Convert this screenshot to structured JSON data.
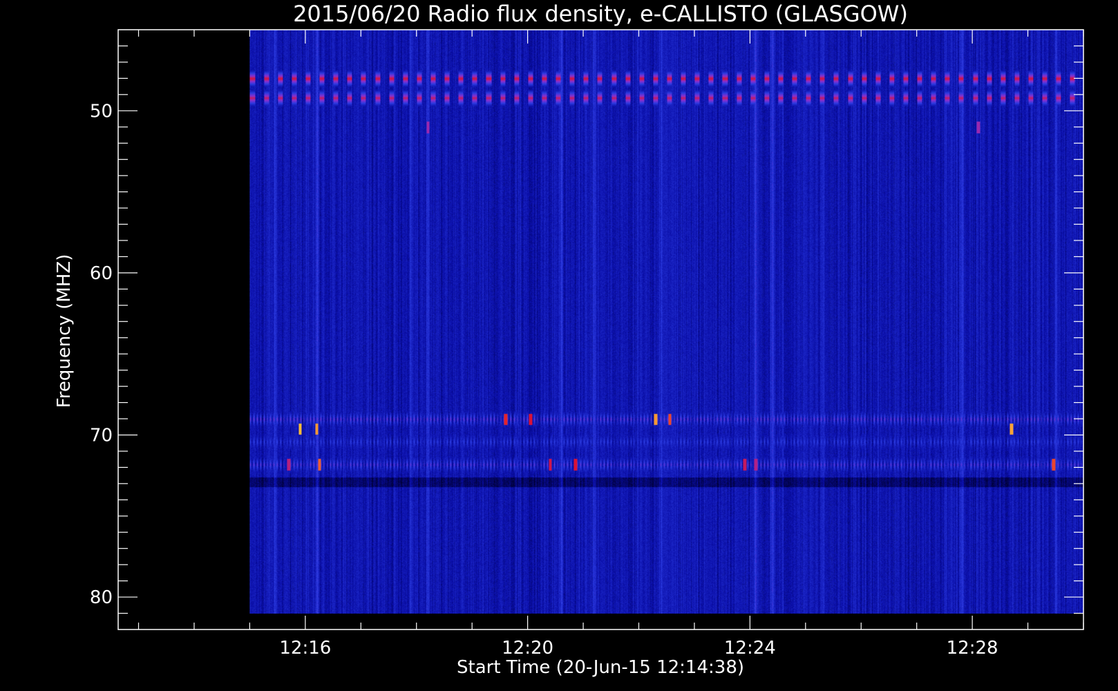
{
  "chart_data": {
    "type": "heatmap",
    "title": "2015/06/20  Radio flux density, e-CALLISTO (GLASGOW)",
    "xlabel": "Start Time (20-Jun-15 12:14:38)",
    "ylabel": "Frequency (MHZ)",
    "x_range_minutes": [
      12.633,
      30.0
    ],
    "data_x_range_minutes": [
      15.0,
      30.0
    ],
    "y_range_mhz": [
      45.0,
      82.0
    ],
    "data_y_range_mhz": [
      45.0,
      81.0
    ],
    "x_ticks": [
      {
        "value": 16,
        "label": "12:16"
      },
      {
        "value": 20,
        "label": "12:20"
      },
      {
        "value": 24,
        "label": "12:24"
      },
      {
        "value": 28,
        "label": "12:28"
      }
    ],
    "x_minor_step_minutes": 1,
    "y_ticks": [
      {
        "value": 50,
        "label": "50"
      },
      {
        "value": 60,
        "label": "60"
      },
      {
        "value": 70,
        "label": "70"
      },
      {
        "value": 80,
        "label": "80"
      }
    ],
    "y_minor_step_mhz": 1,
    "y_inverted": true,
    "colormap": [
      "#000000",
      "#00003a",
      "#0a0ea8",
      "#2a3ae0",
      "#8a2fd0",
      "#e0102a",
      "#ffd23a"
    ],
    "background_level": 0.36,
    "interference_bands_mhz": [
      {
        "center": 48.0,
        "period_min": 0.25,
        "peak": 0.82
      },
      {
        "center": 49.2,
        "period_min": 0.25,
        "peak": 0.78
      },
      {
        "center": 69.0,
        "period_min": 0.06,
        "peak": 0.6
      },
      {
        "center": 70.4,
        "period_min": 0.06,
        "peak": 0.5
      },
      {
        "center": 71.8,
        "period_min": 0.06,
        "peak": 0.58
      }
    ],
    "vertical_streaks_minutes": [
      15.45,
      16.2,
      17.9,
      18.2,
      20.6,
      21.2,
      22.4,
      24.1,
      24.4,
      25.3,
      27.8,
      29.5
    ],
    "hot_spots": [
      {
        "t": 15.9,
        "f": 69.6,
        "level": 0.98
      },
      {
        "t": 16.2,
        "f": 69.6,
        "level": 0.95
      },
      {
        "t": 16.25,
        "f": 71.8,
        "level": 0.9
      },
      {
        "t": 15.7,
        "f": 71.8,
        "level": 0.75
      },
      {
        "t": 18.2,
        "f": 51.0,
        "level": 0.7
      },
      {
        "t": 28.1,
        "f": 51.0,
        "level": 0.7
      },
      {
        "t": 19.6,
        "f": 69.0,
        "level": 0.85
      },
      {
        "t": 20.05,
        "f": 69.0,
        "level": 0.82
      },
      {
        "t": 20.4,
        "f": 71.8,
        "level": 0.8
      },
      {
        "t": 20.85,
        "f": 71.8,
        "level": 0.82
      },
      {
        "t": 22.3,
        "f": 69.0,
        "level": 0.95
      },
      {
        "t": 22.55,
        "f": 69.0,
        "level": 0.88
      },
      {
        "t": 23.9,
        "f": 71.8,
        "level": 0.78
      },
      {
        "t": 24.1,
        "f": 71.8,
        "level": 0.74
      },
      {
        "t": 28.7,
        "f": 69.6,
        "level": 0.96
      },
      {
        "t": 29.45,
        "f": 71.8,
        "level": 0.88
      }
    ]
  }
}
